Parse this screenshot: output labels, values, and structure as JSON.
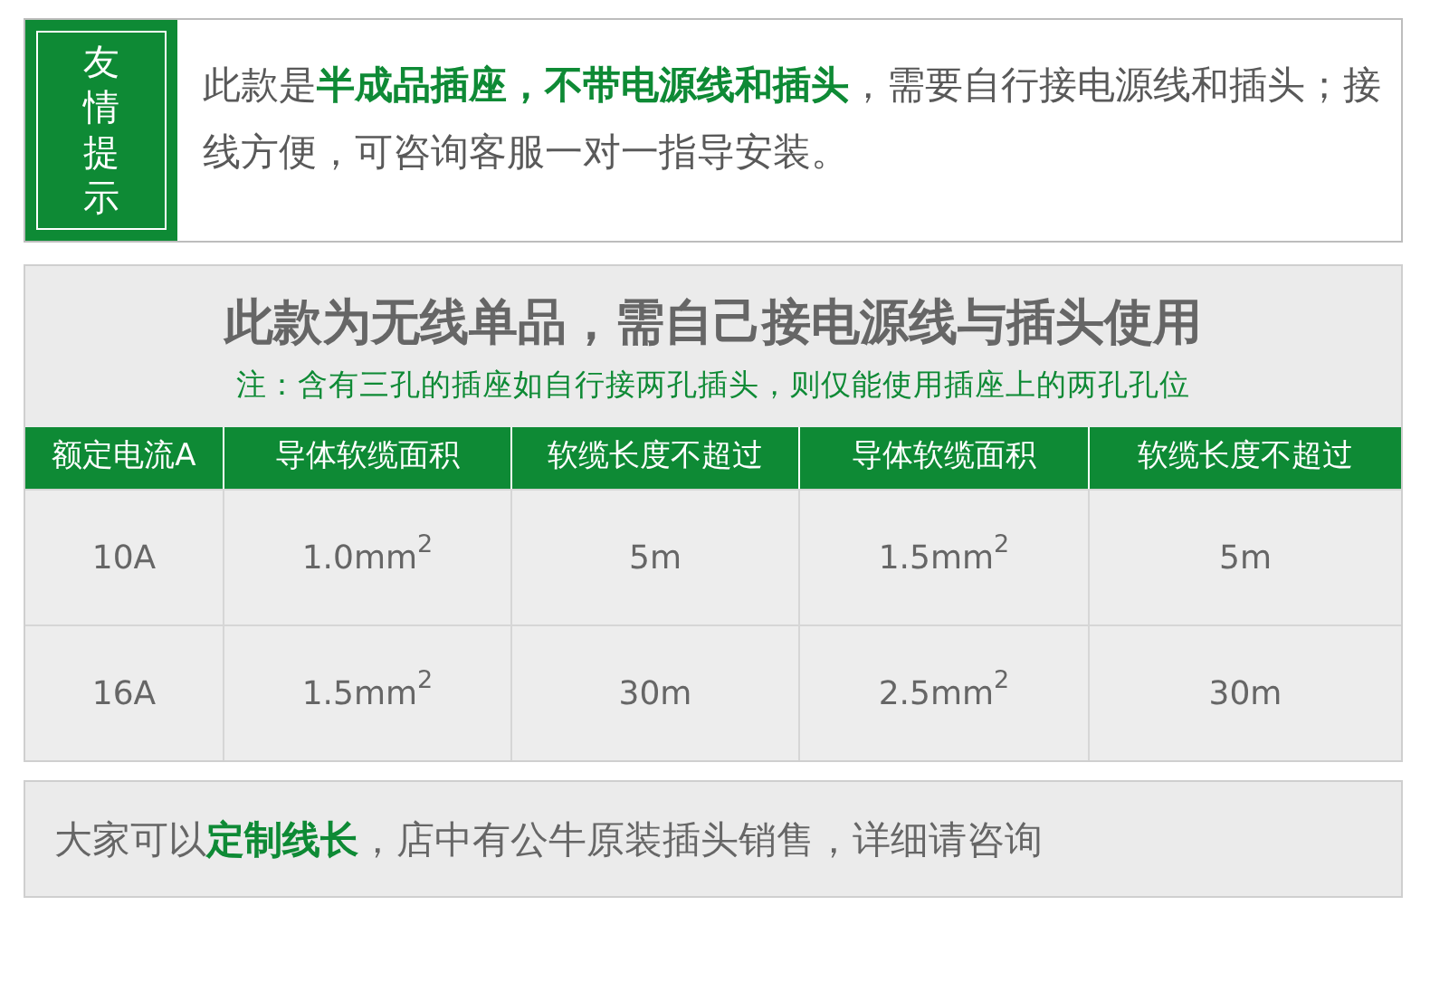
{
  "notice": {
    "tag": "友情提示",
    "text": "此款是**半成品插座，不带电源线和插头**，需要自行接电源线和插头；接线方便，可咨询客服一对一指导安装。"
  },
  "spec": {
    "title": "此款为无线单品，需自己接电源线与插头使用",
    "note": "注：含有三孔的插座如自行接两孔插头，则仅能使用插座上的两孔孔位",
    "table": {
      "columns": [
        "额定电流A",
        "导体软缆面积",
        "软缆长度不超过",
        "导体软缆面积",
        "软缆长度不超过"
      ],
      "rows": [
        [
          "10A",
          "1.0mm$^{2}$",
          "5m",
          "1.5mm$^{2}$",
          "5m"
        ],
        [
          "16A",
          "1.5mm$^{2}$",
          "30m",
          "2.5mm$^{2}$",
          "30m"
        ]
      ]
    }
  },
  "footer_note": "大家可以**定制线长**，店中有公牛原装插头销售，详细请咨询"
}
